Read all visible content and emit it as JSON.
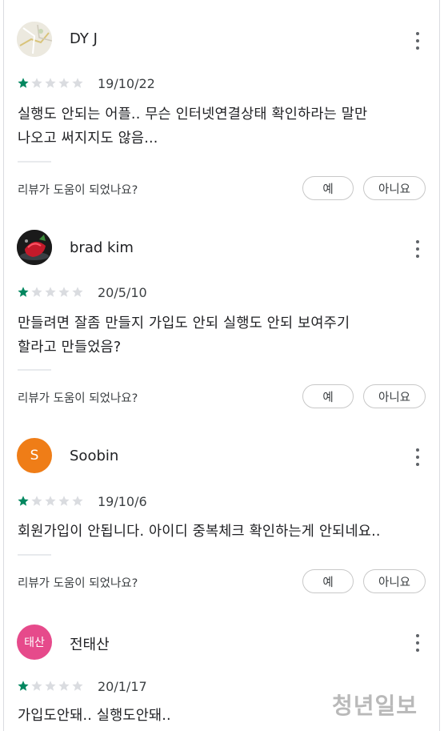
{
  "reviews": [
    {
      "name": "DY J",
      "avatar": {
        "kind": "map-image",
        "icon": "map-thumbnail",
        "bg": "#e9e6dc"
      },
      "rating": 1,
      "date": "19/10/22",
      "text_lines": [
        "실행도 안되는 어플.. 무슨 인터넷연결상태 확인하라는 말만",
        "나오고 써지지도 않음..."
      ],
      "helpful_question": "리뷰가 도움이 되었나요?",
      "yes_label": "예",
      "no_label": "아니요"
    },
    {
      "name": "brad kim",
      "avatar": {
        "kind": "photo",
        "icon": "strawberry-photo",
        "bg": "#1b1b1b"
      },
      "rating": 1,
      "date": "20/5/10",
      "text_lines": [
        "만들려면 잘좀 만들지 가입도 안되 실행도 안되 보여주기",
        "할라고 만들었음?"
      ],
      "helpful_question": "리뷰가 도움이 되었나요?",
      "yes_label": "예",
      "no_label": "아니요"
    },
    {
      "name": "Soobin",
      "avatar": {
        "kind": "letter",
        "letter": "S",
        "bg": "#ef7d17"
      },
      "rating": 1,
      "date": "19/10/6",
      "text_lines": [
        "회원가입이 안됩니다. 아이디 중복체크 확인하는게 안되네요.."
      ],
      "helpful_question": "리뷰가 도움이 되었나요?",
      "yes_label": "예",
      "no_label": "아니요"
    },
    {
      "name": "전태산",
      "avatar": {
        "kind": "letter",
        "letter": "태산",
        "bg": "#e64a8b"
      },
      "rating": 1,
      "date": "20/1/17",
      "text_lines": [
        "가입도안돼.. 실행도안돼.."
      ]
    }
  ],
  "star_colors": {
    "filled": "#01875f",
    "empty": "#dadce0"
  },
  "watermark": "청년일보"
}
